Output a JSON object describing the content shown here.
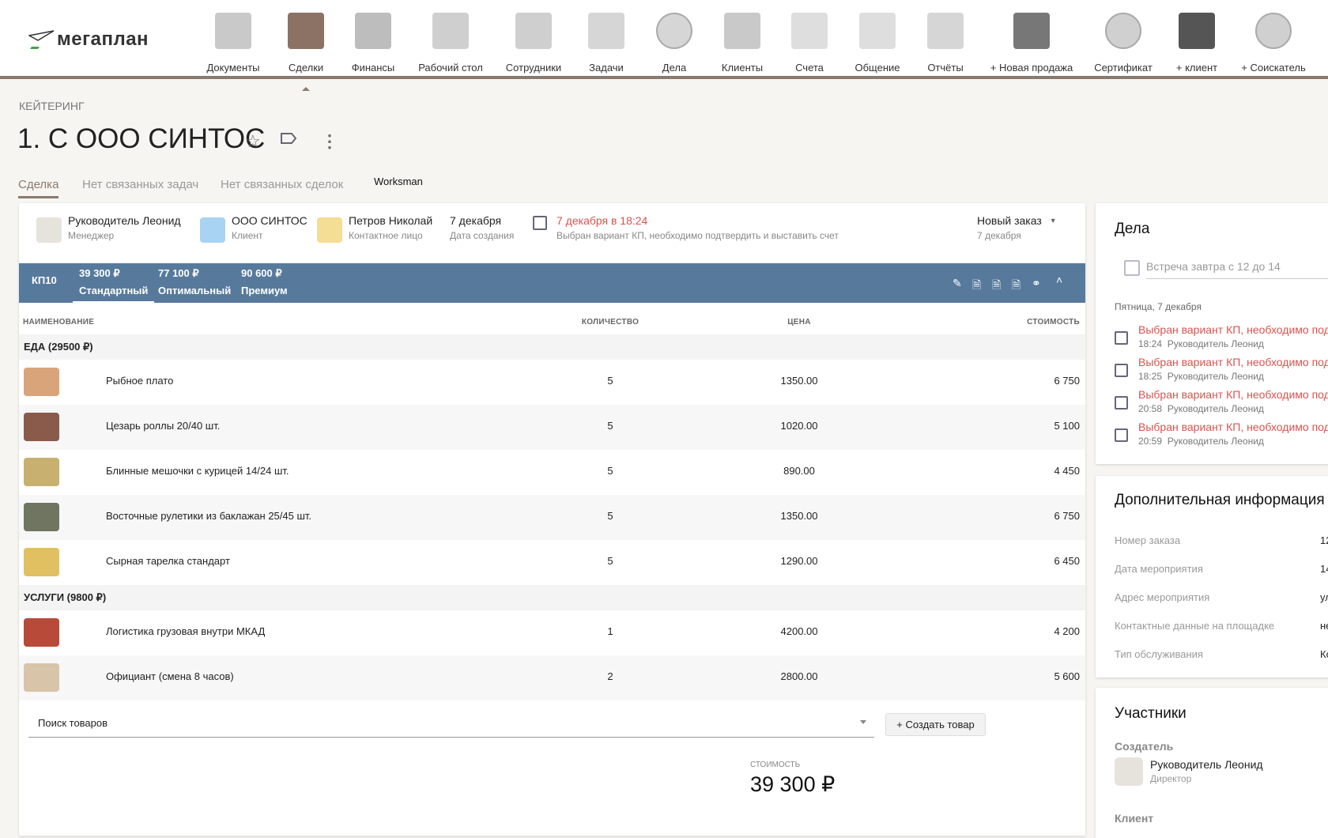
{
  "header": {
    "logo": "мегаплан",
    "nav": [
      {
        "label": "Документы",
        "icon": "folder-icon",
        "color": "#c9c9c9"
      },
      {
        "label": "Сделки",
        "icon": "briefcase-icon",
        "color": "#8b7265",
        "active": true
      },
      {
        "label": "Финансы",
        "icon": "safe-icon",
        "color": "#bdbdbd"
      },
      {
        "label": "Рабочий стол",
        "icon": "dashboard-icon",
        "color": "#cfcfcf"
      },
      {
        "label": "Сотрудники",
        "icon": "id-cards-icon",
        "color": "#cfcfcf"
      },
      {
        "label": "Задачи",
        "icon": "clipboard-icon",
        "color": "#d6d6d6"
      },
      {
        "label": "Дела",
        "icon": "clock-icon",
        "color": "#d6d6d6"
      },
      {
        "label": "Клиенты",
        "icon": "contacts-book-icon",
        "color": "#c9c9c9"
      },
      {
        "label": "Счета",
        "icon": "invoice-icon",
        "color": "#dedede"
      },
      {
        "label": "Общение",
        "icon": "chat-icon",
        "color": "#dedede"
      },
      {
        "label": "Отчёты",
        "icon": "report-chart-icon",
        "color": "#d6d6d6"
      },
      {
        "label": "+ Новая продажа",
        "icon": "new-sale-icon",
        "color": "#777777"
      },
      {
        "label": "Сертификат",
        "icon": "globe-icon",
        "color": "#d0d0d0"
      },
      {
        "label": "+ клиент",
        "icon": "add-client-icon",
        "color": "#555555"
      },
      {
        "label": "+ Соискатель",
        "icon": "globe-icon",
        "color": "#d0d0d0"
      }
    ]
  },
  "breadcrumb": "КЕЙТЕРИНГ",
  "title": "1. С ООО СИНТОС",
  "tabs": [
    "Сделка",
    "Нет связанных задач",
    "Нет связанных сделок",
    "Worksman"
  ],
  "info": {
    "manager": {
      "name": "Руководитель Леонид",
      "role": "Менеджер"
    },
    "client": {
      "name": "ООО СИНТОС",
      "role": "Клиент"
    },
    "contact": {
      "name": "Петров Николай",
      "role": "Контактное лицо"
    },
    "created": {
      "value": "7 декабря",
      "label": "Дата создания"
    },
    "task": {
      "date": "7 декабря в 18:24",
      "text": "Выбран вариант КП, необходимо подтвердить и выставить счет"
    },
    "status": {
      "value": "Новый заказ",
      "date": "7 декабря"
    }
  },
  "kp": {
    "label": "КП10",
    "variants": [
      {
        "sum": "39 300 ₽",
        "name": "Стандартный"
      },
      {
        "sum": "77 100 ₽",
        "name": "Оптимальный"
      },
      {
        "sum": "90 600 ₽",
        "name": "Премиум"
      }
    ]
  },
  "table": {
    "headers": [
      "НАИМЕНОВАНИЕ",
      "КОЛИЧЕСТВО",
      "ЦЕНА",
      "СТОИМОСТЬ"
    ],
    "groups": [
      {
        "title": "ЕДА (29500 ₽)",
        "items": [
          {
            "name": "Рыбное плато",
            "qty": "5",
            "price": "1350.00",
            "cost": "6 750",
            "color": "#d9a47a"
          },
          {
            "name": "Цезарь роллы 20/40 шт.",
            "qty": "5",
            "price": "1020.00",
            "cost": "5 100",
            "color": "#8a5a4a"
          },
          {
            "name": "Блинные мешочки с курицей 14/24 шт.",
            "qty": "5",
            "price": "890.00",
            "cost": "4 450",
            "color": "#c7b070"
          },
          {
            "name": "Восточные рулетики из баклажан 25/45 шт.",
            "qty": "5",
            "price": "1350.00",
            "cost": "6 750",
            "color": "#6f7560"
          },
          {
            "name": "Сырная тарелка стандарт",
            "qty": "5",
            "price": "1290.00",
            "cost": "6 450",
            "color": "#e0c060"
          }
        ]
      },
      {
        "title": "УСЛУГИ (9800 ₽)",
        "items": [
          {
            "name": "Логистика грузовая внутри МКАД",
            "qty": "1",
            "price": "4200.00",
            "cost": "4 200",
            "color": "#b84a3a"
          },
          {
            "name": "Официант (смена 8 часов)",
            "qty": "2",
            "price": "2800.00",
            "cost": "5 600",
            "color": "#d8c4a8"
          }
        ]
      }
    ]
  },
  "search_placeholder": "Поиск товаров",
  "create_button": "+ Создать товар",
  "total": {
    "label": "СТОИМОСТЬ",
    "value": "39 300 ₽"
  },
  "dela": {
    "title": "Дела",
    "input_placeholder": "Встреча завтра с 12 до 14",
    "day": "Пятница, 7 декабря",
    "tasks": [
      {
        "text": "Выбран вариант КП, необходимо подтвердить и выставить счет",
        "time": "18:24",
        "author": "Руководитель Леонид"
      },
      {
        "text": "Выбран вариант КП, необходимо подтвердить и выставить счет",
        "time": "18:25",
        "author": "Руководитель Леонид"
      },
      {
        "text": "Выбран вариант КП, необходимо подтвердить и выставить счет",
        "time": "20:58",
        "author": "Руководитель Леонид"
      },
      {
        "text": "Выбран вариант КП, необходимо подтвердить и выставить счет",
        "time": "20:59",
        "author": "Руководитель Леонид"
      }
    ]
  },
  "extra": {
    "title": "Дополнительная информация",
    "fields": [
      {
        "label": "Номер заказа",
        "value": "12"
      },
      {
        "label": "Дата мероприятия",
        "value": "14"
      },
      {
        "label": "Адрес мероприятия",
        "value": "ул"
      },
      {
        "label": "Контактные данные на площадке",
        "value": "не"
      },
      {
        "label": "Тип обслуживания",
        "value": "Ко"
      }
    ]
  },
  "participants": {
    "title": "Участники",
    "creator_label": "Создатель",
    "creator": {
      "name": "Руководитель Леонид",
      "role": "Директор"
    },
    "client_label": "Клиент"
  },
  "colors": {
    "accent": "#8a7a6e",
    "kp_bar": "#577a9c",
    "task_red": "#d9534f"
  }
}
